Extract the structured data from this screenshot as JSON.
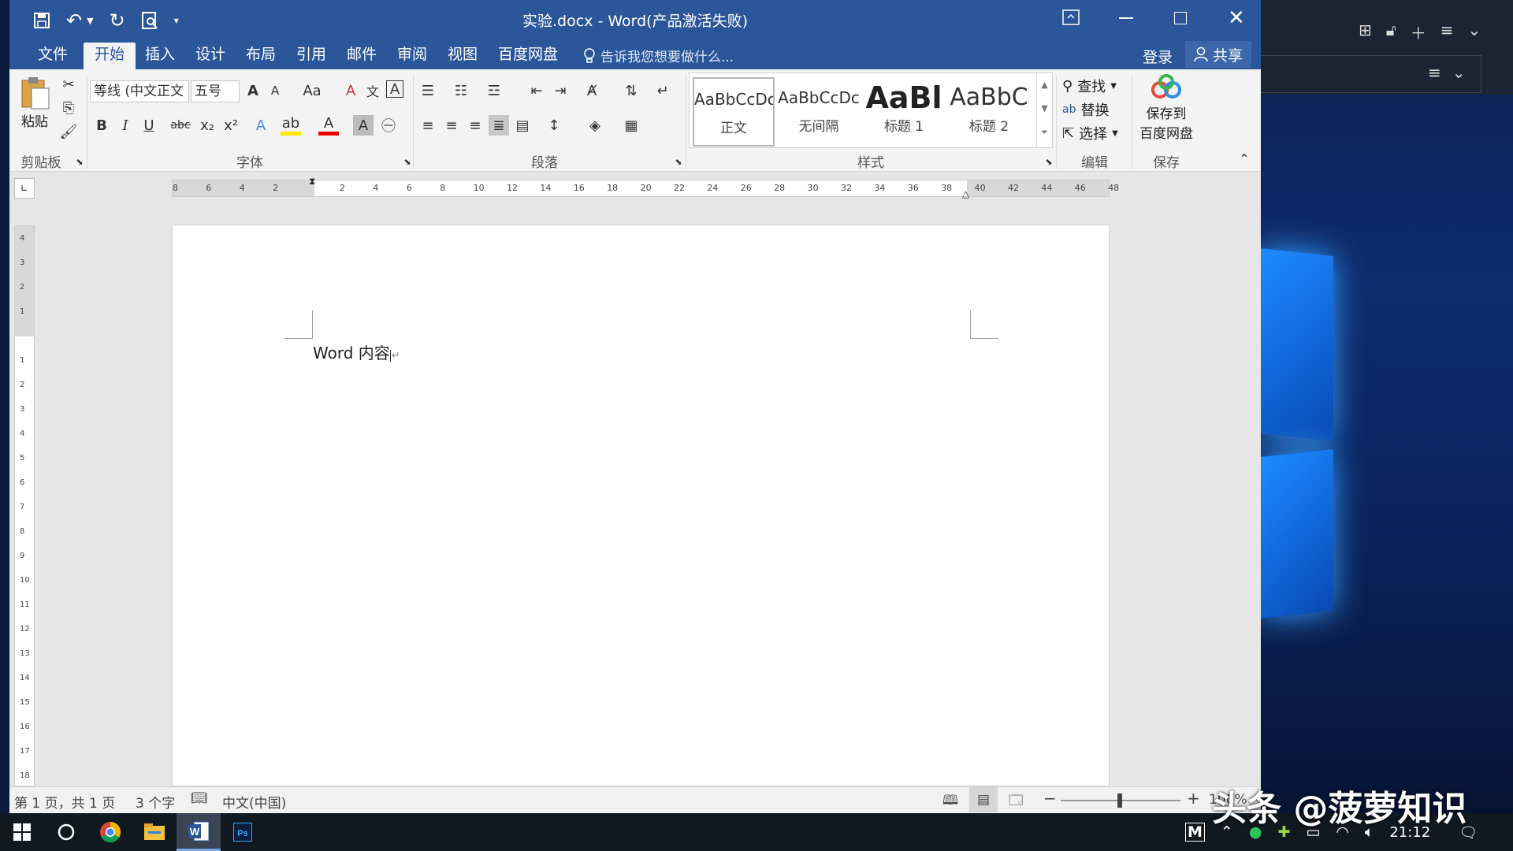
{
  "window": {
    "title": "实验.docx - Word(产品激活失败)",
    "controls": [
      "ribbon-display-options-icon",
      "minimize-icon",
      "maximize-icon",
      "close-icon"
    ]
  },
  "quick_access": [
    "save-icon",
    "undo-icon",
    "redo-icon",
    "print-preview-icon",
    "customize-icon"
  ],
  "tabs": [
    {
      "label": "文件",
      "active": false
    },
    {
      "label": "开始",
      "active": true
    },
    {
      "label": "插入",
      "active": false
    },
    {
      "label": "设计",
      "active": false
    },
    {
      "label": "布局",
      "active": false
    },
    {
      "label": "引用",
      "active": false
    },
    {
      "label": "邮件",
      "active": false
    },
    {
      "label": "审阅",
      "active": false
    },
    {
      "label": "视图",
      "active": false
    },
    {
      "label": "百度网盘",
      "active": false
    }
  ],
  "tell_me": "告诉我您想要做什么...",
  "account": {
    "login": "登录",
    "share": "共享"
  },
  "ribbon": {
    "clipboard": {
      "paste": "粘贴",
      "group": "剪贴板"
    },
    "font": {
      "name": "等线 (中文正文",
      "size": "五号",
      "group": "字体",
      "change_case": "Aa"
    },
    "paragraph": {
      "group": "段落"
    },
    "styles": {
      "group": "样式",
      "items": [
        {
          "preview": "AaBbCcDc",
          "name": "正文",
          "selected": true
        },
        {
          "preview": "AaBbCcDc",
          "name": "无间隔",
          "selected": false
        },
        {
          "preview": "AaBl",
          "name": "标题 1",
          "selected": false
        },
        {
          "preview": "AaBbC",
          "name": "标题 2",
          "selected": false
        }
      ]
    },
    "editing": {
      "find": "查找",
      "replace": "替换",
      "select": "选择",
      "group": "编辑"
    },
    "save": {
      "label1": "保存到",
      "label2": "百度网盘",
      "group": "保存"
    }
  },
  "ruler": {
    "ticks": [
      "8",
      "6",
      "4",
      "2",
      "",
      "2",
      "4",
      "6",
      "8",
      "10",
      "12",
      "14",
      "16",
      "18",
      "20",
      "22",
      "24",
      "26",
      "28",
      "30",
      "32",
      "34",
      "36",
      "38",
      "40",
      "42",
      "44",
      "46",
      "48"
    ],
    "vticks": [
      "4",
      "3",
      "2",
      "1",
      "",
      "1",
      "2",
      "3",
      "4",
      "5",
      "6",
      "7",
      "8",
      "9",
      "10",
      "11",
      "12",
      "13",
      "14",
      "15",
      "16",
      "17",
      "18"
    ]
  },
  "document": {
    "text": "Word 内容"
  },
  "status": {
    "page": "第 1 页，共 1 页",
    "words": "3 个字",
    "language": "中文(中国)",
    "zoom": "100%"
  },
  "taskbar": {
    "apps": [
      "start-icon",
      "cortana-icon",
      "chrome-icon",
      "file-explorer-icon",
      "word-icon",
      "photoshop-icon"
    ],
    "time": "21:12"
  },
  "watermark": "头条 @菠萝知识"
}
